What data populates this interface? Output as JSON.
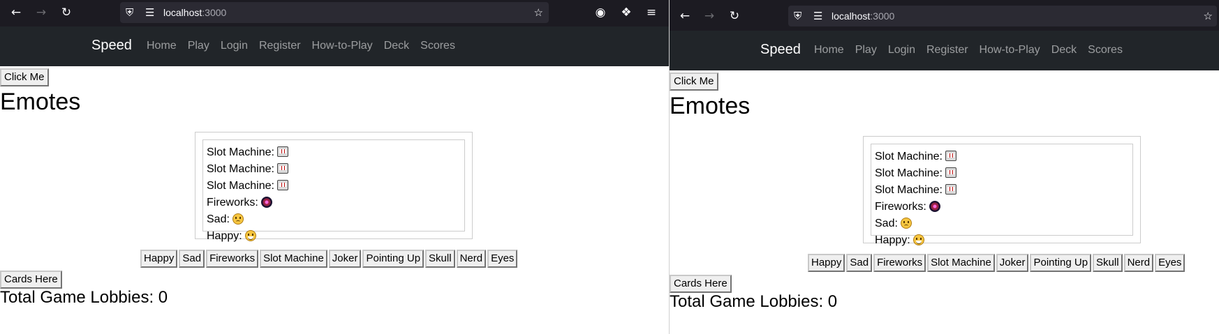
{
  "browser": {
    "url_host": "localhost",
    "url_port": ":3000"
  },
  "icons": {
    "back": "arrow-left-icon",
    "forward": "arrow-right-icon",
    "reload": "reload-icon",
    "shield": "shield-icon",
    "page": "page-icon",
    "bookmark": "star-icon",
    "pocket": "pocket-icon",
    "extensions": "puzzle-icon",
    "menu": "hamburger-icon"
  },
  "navbar": {
    "brand": "Speed",
    "links": [
      "Home",
      "Play",
      "Login",
      "Register",
      "How-to-Play",
      "Deck",
      "Scores"
    ]
  },
  "content": {
    "click_me": "Click Me",
    "title": "Emotes",
    "emotes": [
      {
        "label": "Slot Machine:",
        "icon": "slot-machine-icon"
      },
      {
        "label": "Slot Machine:",
        "icon": "slot-machine-icon"
      },
      {
        "label": "Slot Machine:",
        "icon": "slot-machine-icon"
      },
      {
        "label": "Fireworks:",
        "icon": "fireworks-icon"
      },
      {
        "label": "Sad:",
        "icon": "sad-face-icon"
      },
      {
        "label": "Happy:",
        "icon": "happy-face-icon"
      }
    ],
    "emote_buttons": [
      "Happy",
      "Sad",
      "Fireworks",
      "Slot Machine",
      "Joker",
      "Pointing Up",
      "Skull",
      "Nerd",
      "Eyes"
    ],
    "cards_here": "Cards Here",
    "lobbies": "Total Game Lobbies: 0"
  },
  "colors": {
    "toolbar": "#1c1b22",
    "urlbar": "#2b2a33",
    "navbar": "#212529"
  }
}
